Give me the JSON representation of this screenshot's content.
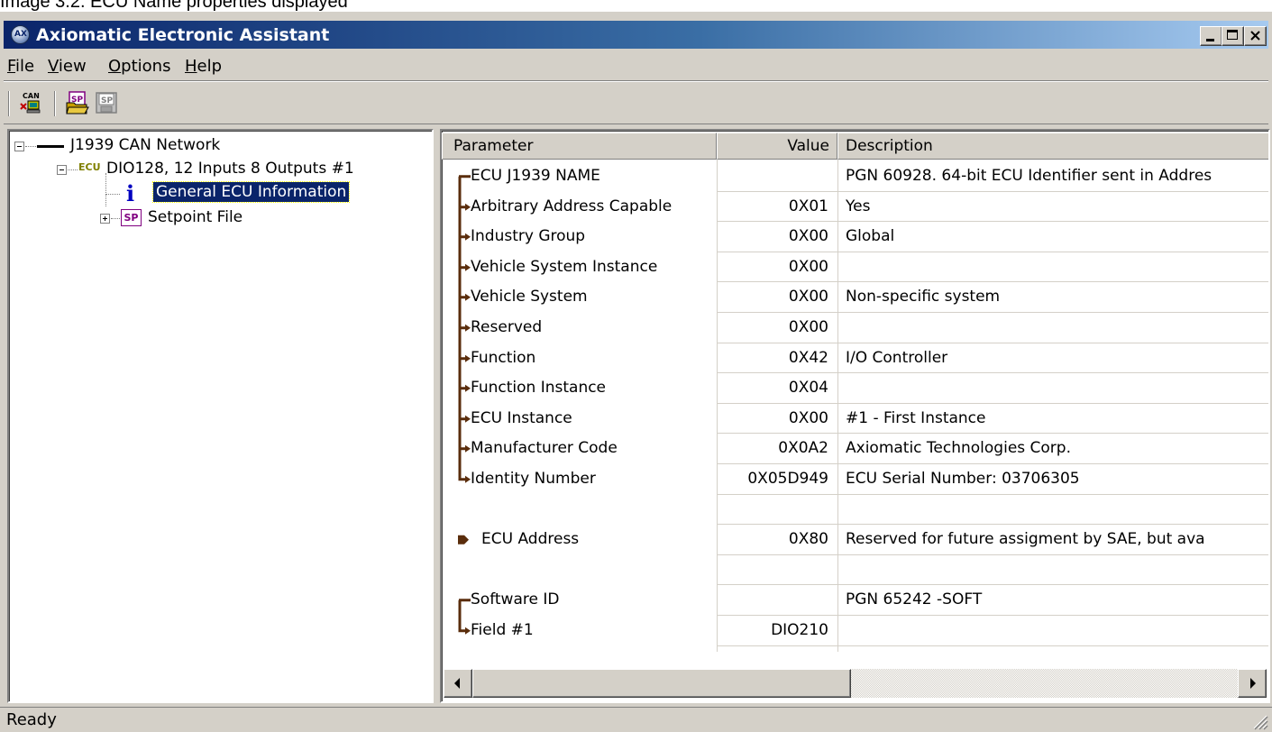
{
  "caption": "Image 3.2. ECU Name properties displayed",
  "window": {
    "title": "Axiomatic Electronic Assistant",
    "minimize_icon": "minimize-icon",
    "maximize_icon": "maximize-icon",
    "close_icon": "close-icon"
  },
  "menu": {
    "file": "File",
    "view": "View",
    "options": "Options",
    "help": "Help"
  },
  "toolbar": {
    "buttons": [
      {
        "icon": "can-connect-icon",
        "label": "CAN"
      },
      {
        "icon": "open-setpoint-file-icon",
        "label": "SP"
      },
      {
        "icon": "save-setpoint-file-icon",
        "label": "SP"
      }
    ]
  },
  "tree": {
    "network": "J1939 CAN Network",
    "ecu_badge": "ECU",
    "ecu": "DIO128, 12 Inputs 8 Outputs #1",
    "info_icon": "i",
    "general": "General ECU Information",
    "sp_badge": "SP",
    "setpoint": "Setpoint File"
  },
  "table": {
    "headers": {
      "parameter": "Parameter",
      "value": "Value",
      "description": "Description"
    },
    "rows": [
      {
        "marker": "branch-start",
        "parameter": "ECU J1939 NAME",
        "value": "",
        "description": "PGN 60928. 64-bit ECU Identifier sent in Addres"
      },
      {
        "marker": "branch-mid",
        "parameter": "Arbitrary Address Capable",
        "value": "0X01",
        "description": "Yes"
      },
      {
        "marker": "branch-mid",
        "parameter": "Industry Group",
        "value": "0X00",
        "description": "Global"
      },
      {
        "marker": "branch-mid",
        "parameter": "Vehicle System Instance",
        "value": "0X00",
        "description": ""
      },
      {
        "marker": "branch-mid",
        "parameter": "Vehicle System",
        "value": "0X00",
        "description": "Non-specific system"
      },
      {
        "marker": "branch-mid",
        "parameter": "Reserved",
        "value": "0X00",
        "description": ""
      },
      {
        "marker": "branch-mid",
        "parameter": "Function",
        "value": "0X42",
        "description": "I/O Controller"
      },
      {
        "marker": "branch-mid",
        "parameter": "Function Instance",
        "value": "0X04",
        "description": ""
      },
      {
        "marker": "branch-mid",
        "parameter": "ECU Instance",
        "value": "0X00",
        "description": "#1 - First Instance"
      },
      {
        "marker": "branch-mid",
        "parameter": "Manufacturer Code",
        "value": "0X0A2",
        "description": "Axiomatic Technologies Corp."
      },
      {
        "marker": "branch-end",
        "parameter": "Identity Number",
        "value": "0X05D949",
        "description": "ECU Serial Number: 03706305"
      },
      {
        "marker": "none",
        "parameter": "",
        "value": "",
        "description": ""
      },
      {
        "marker": "single",
        "parameter": "ECU Address",
        "value": "0X80",
        "description": "Reserved for future assigment by SAE, but ava"
      },
      {
        "marker": "none",
        "parameter": "",
        "value": "",
        "description": ""
      },
      {
        "marker": "branch-start",
        "parameter": "Software ID",
        "value": "",
        "description": "PGN 65242   -SOFT"
      },
      {
        "marker": "branch-end",
        "parameter": "Field #1",
        "value": "DIO210",
        "description": ""
      }
    ]
  },
  "status": {
    "text": "Ready"
  },
  "colors": {
    "title_gradient_start": "#0a246a",
    "title_gradient_end": "#a6caf0",
    "selection": "#0a246a",
    "marker": "#5a2d0c",
    "ecu_badge": "#808000",
    "sp_badge": "#800080"
  }
}
